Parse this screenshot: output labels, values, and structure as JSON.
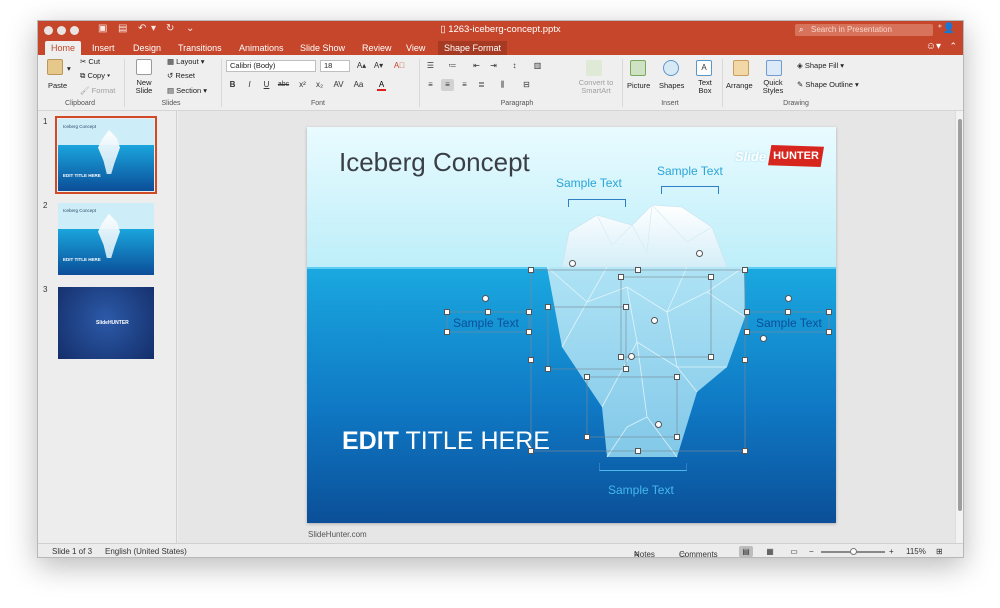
{
  "window": {
    "doc_title": "1263-iceberg-concept.pptx",
    "search_placeholder": "Search in Presentation"
  },
  "tabs": [
    {
      "label": "Home",
      "active": true
    },
    {
      "label": "Insert"
    },
    {
      "label": "Design"
    },
    {
      "label": "Transitions"
    },
    {
      "label": "Animations"
    },
    {
      "label": "Slide Show"
    },
    {
      "label": "Review"
    },
    {
      "label": "View"
    },
    {
      "label": "Shape Format",
      "contextual": true
    }
  ],
  "ribbon": {
    "clipboard": {
      "group": "Clipboard",
      "paste": "Paste",
      "cut": "Cut",
      "copy": "Copy",
      "format": "Format"
    },
    "slides": {
      "group": "Slides",
      "new_slide": "New Slide",
      "layout": "Layout",
      "reset": "Reset",
      "section": "Section"
    },
    "font": {
      "group": "Font",
      "font_name": "Calibri (Body)",
      "font_size": "18"
    },
    "paragraph": {
      "group": "Paragraph",
      "convert_smartart": "Convert to SmartArt"
    },
    "insert": {
      "group": "Insert",
      "picture": "Picture",
      "shapes": "Shapes",
      "text_box": "Text Box"
    },
    "drawing": {
      "group": "Drawing",
      "arrange": "Arrange",
      "quick_styles": "Quick Styles",
      "shape_fill": "Shape Fill",
      "shape_outline": "Shape Outline"
    }
  },
  "thumbnails": [
    {
      "num": "1",
      "title": "Iceberg Concept",
      "edit": "EDIT TITLE HERE",
      "selected": true
    },
    {
      "num": "2",
      "title": "Iceberg Concept",
      "edit": "EDIT TITLE HERE"
    },
    {
      "num": "3",
      "logo": "SlideHUNTER"
    }
  ],
  "slide": {
    "title": "Iceberg Concept",
    "logo_slide": "Slide",
    "logo_hunter": "HUNTER",
    "sample_top_left": "Sample Text",
    "sample_top_right": "Sample Text",
    "sample_mid_left": "Sample Text",
    "sample_mid_right": "Sample Text",
    "sample_bottom": "Sample Text",
    "edit_title_bold": "EDIT",
    "edit_title_rest": " TITLE HERE",
    "footer_url": "SlideHunter.com"
  },
  "status": {
    "slide_counter": "Slide 1 of 3",
    "language": "English (United States)",
    "notes": "Notes",
    "comments": "Comments",
    "zoom": "115%"
  },
  "colors": {
    "accent": "#c5462a",
    "sea_top": "#1aa8e0",
    "sea_bottom": "#0b4f98",
    "sky": "#d6f4fb"
  }
}
